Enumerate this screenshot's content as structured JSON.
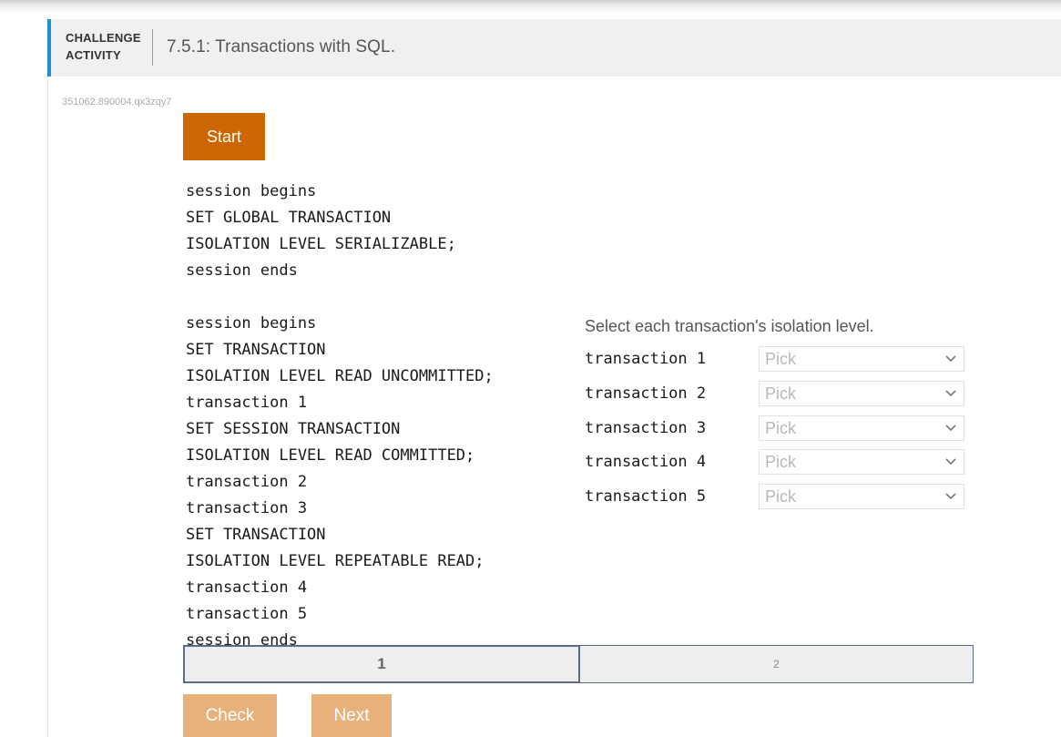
{
  "header": {
    "badge_line1": "CHALLENGE",
    "badge_line2": "ACTIVITY",
    "title": "7.5.1: Transactions with SQL."
  },
  "activity_id": "351062.890004.qx3zqy7",
  "start_label": "Start",
  "code_lines": [
    "session begins",
    "SET GLOBAL TRANSACTION",
    "ISOLATION LEVEL SERIALIZABLE;",
    "session ends",
    "",
    "session begins",
    "SET TRANSACTION",
    "ISOLATION LEVEL READ UNCOMMITTED;",
    "transaction 1",
    "SET SESSION TRANSACTION",
    "ISOLATION LEVEL READ COMMITTED;",
    "transaction 2",
    "transaction 3",
    "SET TRANSACTION",
    "ISOLATION LEVEL REPEATABLE READ;",
    "transaction 4",
    "transaction 5",
    "session ends"
  ],
  "question": {
    "prompt": "Select each transaction's isolation level.",
    "rows": [
      {
        "label": "transaction 1",
        "value": "Pick"
      },
      {
        "label": "transaction 2",
        "value": "Pick"
      },
      {
        "label": "transaction 3",
        "value": "Pick"
      },
      {
        "label": "transaction 4",
        "value": "Pick"
      },
      {
        "label": "transaction 5",
        "value": "Pick"
      }
    ]
  },
  "steps": [
    "1",
    "2"
  ],
  "buttons": {
    "check": "Check",
    "next": "Next"
  },
  "colors": {
    "accent_bar": "#1f8fd1",
    "start": "#cc6600",
    "action_disabled": "#e8b07a",
    "step_border": "#5a6c87"
  }
}
